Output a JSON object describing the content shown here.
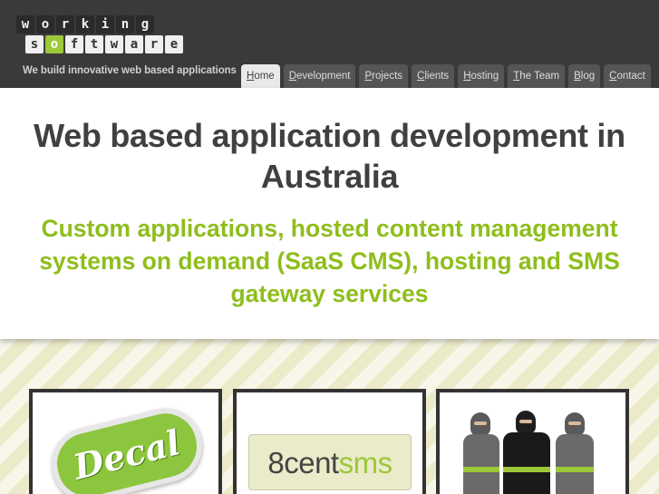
{
  "logo": {
    "top_letters": [
      "w",
      "o",
      "r",
      "k",
      "i",
      "n",
      "g"
    ],
    "bottom_letters": [
      "s",
      "o",
      "f",
      "t",
      "w",
      "a",
      "r",
      "e"
    ],
    "accent": "#9cc83a"
  },
  "tagline": "We build innovative web based applications",
  "nav": {
    "tabs": [
      {
        "first": "H",
        "rest": "ome",
        "active": true
      },
      {
        "first": "D",
        "rest": "evelopment",
        "active": false
      },
      {
        "first": "P",
        "rest": "rojects",
        "active": false
      },
      {
        "first": "C",
        "rest": "lients",
        "active": false
      },
      {
        "first": "H",
        "rest": "osting",
        "active": false
      },
      {
        "first": "T",
        "rest": "he Team",
        "active": false
      },
      {
        "first": "B",
        "rest": "log",
        "active": false
      },
      {
        "first": "C",
        "rest": "ontact",
        "active": false
      }
    ]
  },
  "hero": {
    "title": "Web based application development in Australia",
    "subtitle": "Custom applications, hosted content management systems on demand (SaaS CMS), hosting and SMS gateway services",
    "subtitle_color": "#8ebe1c"
  },
  "cards": {
    "decal": {
      "text": "Decal"
    },
    "sms": {
      "part1": "8cent",
      "part2": "sms"
    },
    "team": {
      "icon": "ninja-team-icon"
    }
  }
}
